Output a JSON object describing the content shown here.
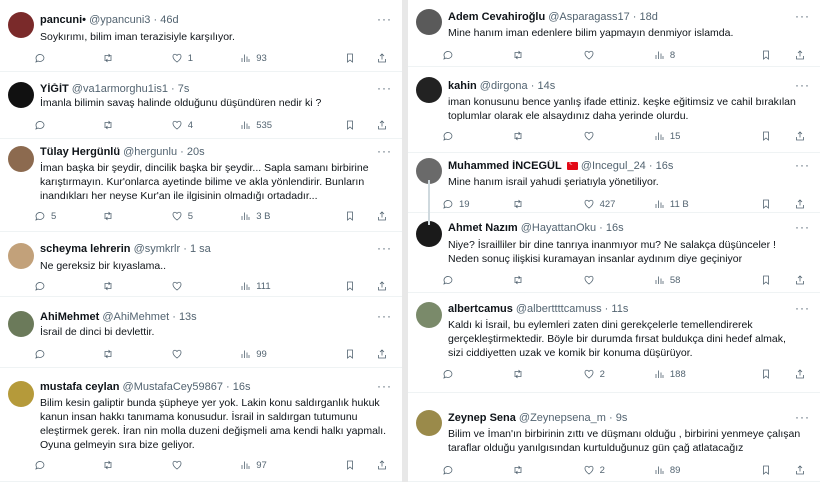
{
  "left_column": [
    {
      "name": "pancuni•",
      "handle": "@ypancuni3",
      "time": "46d",
      "text": [
        "Soykırımı, bilim iman terazisiyle karşılıyor."
      ],
      "replies": "",
      "retweets": "",
      "likes": "1",
      "views": "93",
      "avatar_color": "#7a2a2a"
    },
    {
      "name": "YİĞİT",
      "handle": "@va1armorghu1is1",
      "time": "7s",
      "text": [
        "İmanla bilimin savaş halinde olduğunu düşündüren nedir ki ?"
      ],
      "replies": "",
      "retweets": "",
      "likes": "4",
      "views": "535",
      "avatar_color": "#111111"
    },
    {
      "name": "Tülay Hergünlü",
      "handle": "@hergunlu",
      "time": "20s",
      "text": [
        "İman başka bir şeydir, dincilik başka bir şeydir... Sapla samanı birbirine",
        "karıştırmayın. Kur'onlarca ayetinde bilime ve akla yönlendirir. Bunların",
        "inandıkları her neyse Kur'an ile ilgisinin olmadığı ortadadır..."
      ],
      "replies": "5",
      "retweets": "",
      "likes": "5",
      "views": "3 B",
      "avatar_color": "#8c6a4f"
    },
    {
      "name": "scheyma lehrerin",
      "handle": "@symkrlr",
      "time": "1 sa",
      "text": [
        "Ne gereksiz bir kıyaslama.."
      ],
      "replies": "",
      "retweets": "",
      "likes": "",
      "views": "111",
      "avatar_color": "#c2a17a"
    },
    {
      "name": "AhiMehmet",
      "handle": "@AhiMehmet",
      "time": "13s",
      "text": [
        "İsrail de dinci bi devlettir."
      ],
      "replies": "",
      "retweets": "",
      "likes": "",
      "views": "99",
      "avatar_color": "#6b7a5a"
    },
    {
      "name": "mustafa ceylan",
      "handle": "@MustafaCey59867",
      "time": "16s",
      "text": [
        "Bilim kesin galiptir bunda şüpheye yer yok. Lakin konu saldırganlık hukuk",
        "kanun insan hakkı tanımama konusudur. İsrail in saldırgan tutumunu",
        "eleştirmek gerek. İran nin molla duzeni değişmeli ama kendi halkı yapmalı.",
        "Oyuna gelmeyin sıra bize geliyor."
      ],
      "replies": "",
      "retweets": "",
      "likes": "",
      "views": "97",
      "avatar_color": "#b59a3a"
    }
  ],
  "right_column": [
    {
      "name": "Adem Cevahiroğlu",
      "handle": "@Asparagass17",
      "time": "18d",
      "text": [
        "Mine hanım iman edenlere bilim yapmayın denmiyor islamda."
      ],
      "replies": "",
      "retweets": "",
      "likes": "",
      "views": "8",
      "avatar_color": "#5a5a5a"
    },
    {
      "name": "kahin",
      "handle": "@dirgona",
      "time": "14s",
      "text": [
        "iman konusunu bence yanlış ifade ettiniz. keşke eğitimsiz ve cahil bırakılan",
        "toplumlar olarak ele alsaydınız daha yerinde olurdu."
      ],
      "replies": "",
      "retweets": "",
      "likes": "",
      "views": "15",
      "avatar_color": "#222222"
    },
    {
      "name": "Muhammed İNCEGÜL",
      "handle": "@Incegul_24",
      "time": "16s",
      "text": [
        "Mine hanım israil yahudi şeriatıyla yönetiliyor."
      ],
      "replies": "19",
      "retweets": "",
      "likes": "427",
      "views": "11 B",
      "avatar_color": "#6a6a6a"
    },
    {
      "name": "Ahmet Nazım",
      "handle": "@HayattanOku",
      "time": "16s",
      "text": [
        "Niye? İsrailliler bir dine tanrıya inanmıyor mu? Ne salakça düşünceler !",
        "Neden sonuç ilişkisi kuramayan insanlar aydınım diye geçiniyor"
      ],
      "replies": "",
      "retweets": "",
      "likes": "",
      "views": "58",
      "avatar_color": "#1a1a1a"
    },
    {
      "name": "albertcamus",
      "handle": "@alberttttcamuss",
      "time": "11s",
      "text": [
        "Kaldı ki İsrail, bu eylemleri zaten dini gerekçelerle temellendirerek",
        "gerçekleştirmektedir. Böyle bir durumda fırsat buldukça dini hedef almak,",
        "sizi ciddiyetten uzak ve komik bir konuma düşürüyor."
      ],
      "replies": "",
      "retweets": "",
      "likes": "2",
      "views": "188",
      "avatar_color": "#7a8a6a"
    },
    {
      "name": "Zeynep Sena",
      "handle": "@Zeynepsena_m",
      "time": "9s",
      "text": [
        "Bilim ve İman'ın birbirinin zıttı ve düşmanı olduğu , birbirini yenmeye çalışan",
        "taraflar olduğu yanılgısından kurtulduğunuz gün çağ atlatacağız"
      ],
      "replies": "",
      "retweets": "",
      "likes": "2",
      "views": "89",
      "avatar_color": "#9a8a4a"
    }
  ]
}
